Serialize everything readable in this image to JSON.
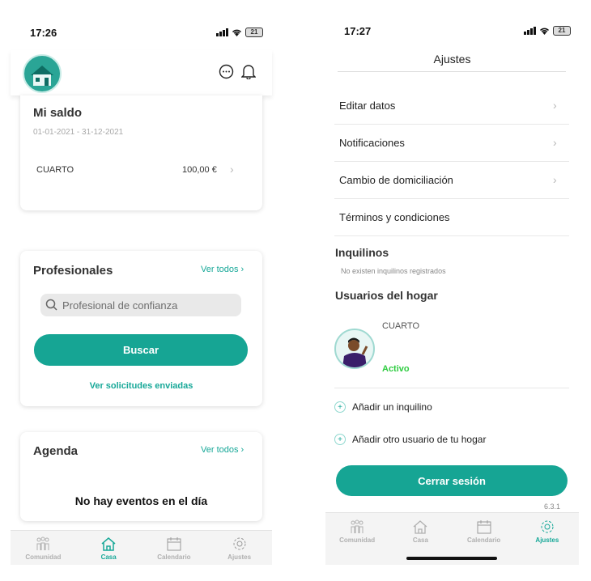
{
  "left": {
    "status": {
      "time": "17:26",
      "battery": "21"
    },
    "saldo": {
      "title": "Mi saldo",
      "period": "01-01-2021 - 31-12-2021",
      "item_label": "CUARTO",
      "item_amount": "100,00 €"
    },
    "profesionales": {
      "title": "Profesionales",
      "see_all": "Ver todos",
      "search_placeholder": "Profesional de confianza",
      "search_button": "Buscar",
      "sent_requests": "Ver solicitudes enviadas"
    },
    "agenda": {
      "title": "Agenda",
      "see_all": "Ver todos",
      "empty": "No hay eventos en el día"
    },
    "tabs": [
      {
        "label": "Comunidad",
        "icon": "community-icon"
      },
      {
        "label": "Casa",
        "icon": "house-icon"
      },
      {
        "label": "Calendario",
        "icon": "calendar-icon"
      },
      {
        "label": "Ajustes",
        "icon": "gear-icon"
      }
    ],
    "active_tab": "Casa"
  },
  "right": {
    "status": {
      "time": "17:27",
      "battery": "21"
    },
    "header_title": "Ajustes",
    "menu": [
      {
        "label": "Editar datos"
      },
      {
        "label": "Notificaciones"
      },
      {
        "label": "Cambio de domiciliación"
      },
      {
        "label": "Términos y condiciones"
      }
    ],
    "inquilinos": {
      "title": "Inquilinos",
      "empty": "No existen inquilinos registrados"
    },
    "usuarios": {
      "title": "Usuarios del hogar",
      "user_name": "CUARTO",
      "user_status": "Activo"
    },
    "add_tenant": "Añadir un inquilino",
    "add_user": "Añadir otro usuario de tu hogar",
    "logout": "Cerrar sesión",
    "version": "6.3.1",
    "tabs": [
      {
        "label": "Comunidad",
        "icon": "community-icon"
      },
      {
        "label": "Casa",
        "icon": "house-icon"
      },
      {
        "label": "Calendario",
        "icon": "calendar-icon"
      },
      {
        "label": "Ajustes",
        "icon": "gear-icon"
      }
    ],
    "active_tab": "Ajustes"
  },
  "colors": {
    "accent": "#17a898",
    "active_status": "#2ecc40"
  }
}
